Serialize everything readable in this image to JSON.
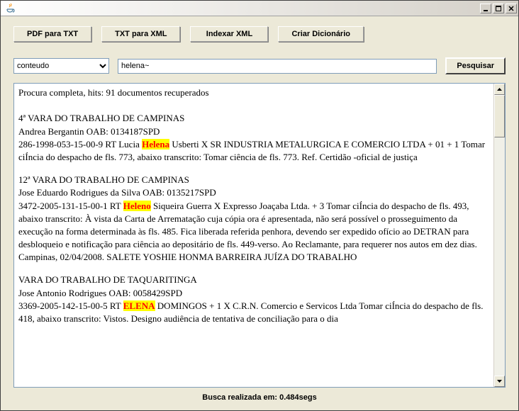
{
  "window": {
    "title": ""
  },
  "toolbar": {
    "pdf_to_txt": "PDF para TXT",
    "txt_to_xml": "TXT para XML",
    "index_xml": "Indexar XML",
    "create_dict": "Criar Dicionário"
  },
  "search": {
    "field_options": [
      "conteudo"
    ],
    "field_selected": "conteudo",
    "query": "helena~",
    "button": "Pesquisar"
  },
  "results": {
    "summary": "Procura completa, hits: 91 documentos recuperados",
    "blocks": [
      {
        "header": "4ª VARA DO TRABALHO DE CAMPINAS",
        "lawyer": "Andrea Bergantin OAB: 0134187SPD",
        "case_prefix": "286-1998-053-15-00-9 RT Lucia ",
        "highlight": "Helena",
        "case_suffix": " Usberti X SR INDUSTRIA METALURGICA E COMERCIO LTDA + 01 + 1 Tomar ciÍncia do despacho de fls. 773, abaixo transcrito: Tomar ciência de fls. 773. Ref. Certidão -oficial de justiça"
      },
      {
        "header": "12ª VARA DO TRABALHO DE CAMPINAS",
        "lawyer": "Jose Eduardo Rodrigues da Silva OAB: 0135217SPD",
        "case_prefix": "3472-2005-131-15-00-1 RT ",
        "highlight": "Heleno",
        "case_suffix": " Siqueira Guerra X Expresso Joaçaba Ltda. + 3 Tomar ciÍncia do despacho de fls. 493, abaixo transcrito: À vista da Carta de Arrematação cuja cópia ora é apresentada, não será possível o prosseguimento da execução na forma determinada às fls. 485. Fica liberada referida penhora, devendo ser expedido ofício ao DETRAN para desbloqueio e notificação para ciência ao depositário de fls. 449-verso. Ao Reclamante, para requerer nos autos em dez dias. Campinas, 02/04/2008. SALETE YOSHIE HONMA BARREIRA JUÍZA DO TRABALHO"
      },
      {
        "header": "VARA DO TRABALHO DE TAQUARITINGA",
        "lawyer": "Jose Antonio Rodrigues OAB: 0058429SPD",
        "case_prefix": "3369-2005-142-15-00-5 RT ",
        "highlight": "ELENA",
        "case_suffix": " DOMINGOS + 1 X C.R.N. Comercio e Servicos Ltda Tomar ciÍncia do despacho de fls. 418, abaixo transcrito: Vistos. Designo audiência de tentativa de conciliação para o dia"
      }
    ]
  },
  "status": "Busca realizada em: 0.484segs"
}
